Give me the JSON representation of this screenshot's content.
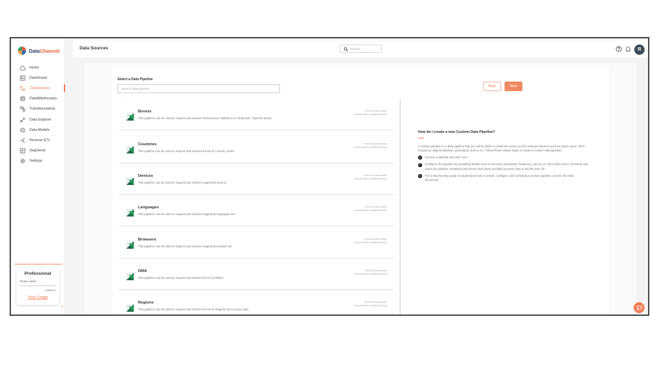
{
  "brand": {
    "name_part1": "Data",
    "name_part2": "Channel"
  },
  "sidebar": {
    "items": [
      {
        "label": "Home",
        "icon": "home-icon"
      },
      {
        "label": "Dashboard",
        "icon": "dashboard-icon"
      },
      {
        "label": "DataSources",
        "icon": "data-sources-icon",
        "active": true
      },
      {
        "label": "DataWarehouses",
        "icon": "database-icon"
      },
      {
        "label": "Transformations",
        "icon": "transform-icon"
      },
      {
        "label": "Data Explorer",
        "icon": "explorer-icon"
      },
      {
        "label": "Data Models",
        "icon": "models-icon"
      },
      {
        "label": "Reverse ETL",
        "icon": "reverse-etl-icon"
      },
      {
        "label": "Segments",
        "icon": "segments-icon"
      },
      {
        "label": "Settings",
        "icon": "gear-icon"
      }
    ],
    "plan": {
      "title": "Professional",
      "rows_label": "Rows Used",
      "count": "0/3650M",
      "link": "View Usage"
    }
  },
  "header": {
    "title": "Data Sources",
    "search_placeholder": "Search..."
  },
  "main": {
    "select_label": "Select a Data Pipeline",
    "pipeline_search_placeholder": "Search data pipeline",
    "back_label": "Back",
    "next_label": "Next",
    "link_report": "Report Documentation",
    "link_docs": "Documentation (Details/Schema)",
    "pipelines": [
      {
        "name": "Boosts",
        "desc": "This pipeline can be used to request and retrieve Performance Statistics for all Boosts / Specific Boost."
      },
      {
        "name": "Countries",
        "desc": "This pipeline can be used to request and retrieve the list of Country codes."
      },
      {
        "name": "Devices",
        "desc": "This pipeline can be used to request and retrieve supported devices."
      },
      {
        "name": "Languages",
        "desc": "This pipeline can be used to request and retrieve supported languages list."
      },
      {
        "name": "Browsers",
        "desc": "This pipeline can be used to request and retrieve supported browser list."
      },
      {
        "name": "DMA",
        "desc": "This pipeline can be used to request and retrieve the list of DMAs."
      },
      {
        "name": "Regions",
        "desc": "This pipeline can be used to request and retrieve the list of Regions by Country code."
      }
    ]
  },
  "help": {
    "title": "How do I create a new Custom Data Pipeline?",
    "intro": "A custom pipeline is a data pipeline that you will be able to customize end to end for various features such as report name, fetch frequency, data breakdown, granularity, and so on. Follow these simple steps to create a custom data pipeline:",
    "steps": [
      {
        "num": "1",
        "text": "Choose a pipeline and click next."
      },
      {
        "num": "2",
        "text": "Configure the pipeline by providing details such as account, granularity, frequency, and so on, then click next to schedule and name the pipeline. Detailed instructions have been provided at every step to aid the form fill."
      },
      {
        "num": "3",
        "text": "For a step-by-step guide to understand how to create, configure, and schedule a custom pipeline, access the Help Document."
      }
    ]
  },
  "colors": {
    "accent": "#ef7f56",
    "avatar_bg": "#3c4a55"
  },
  "user": {
    "initial": "R"
  }
}
